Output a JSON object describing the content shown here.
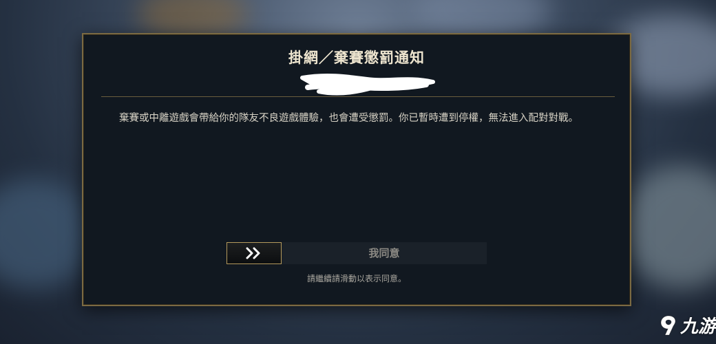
{
  "dialog": {
    "title": "掛網／棄賽懲罰通知",
    "message": "棄賽或中離遊戲會帶給你的隊友不良遊戲體驗，也會遭受懲罰。你已暫時遭到停權，無法進入配對對戰。",
    "slider": {
      "label": "我同意",
      "handle_icon": "double-chevron-right-icon"
    },
    "hint": "請繼續請滑動以表示同意。"
  },
  "watermark": {
    "logo_icon": "9you-logo-icon",
    "text": "九游"
  },
  "colors": {
    "border_gold": "#7b6a43",
    "handle_gold": "#b59a5c",
    "panel_bg": "#111820"
  }
}
